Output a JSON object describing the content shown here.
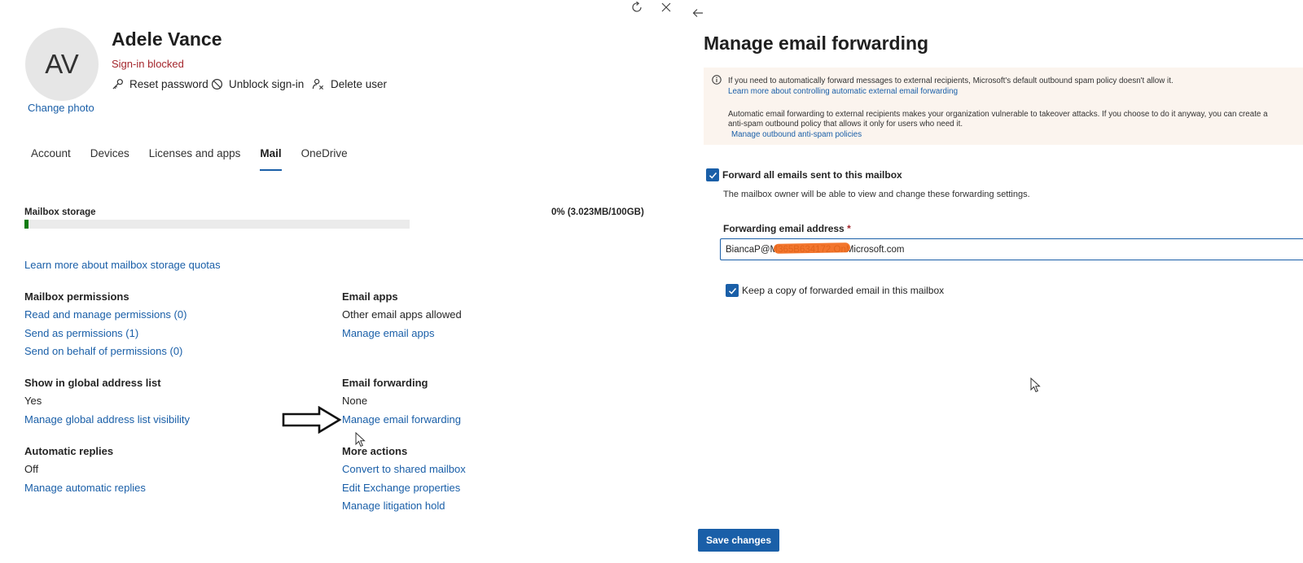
{
  "user": {
    "initials": "AV",
    "change_photo": "Change photo",
    "name": "Adele Vance",
    "status": "Sign-in blocked",
    "actions": {
      "reset_password": "Reset password",
      "unblock_signin": "Unblock sign-in",
      "delete_user": "Delete user"
    }
  },
  "tabs": [
    {
      "label": "Account"
    },
    {
      "label": "Devices"
    },
    {
      "label": "Licenses and apps"
    },
    {
      "label": "Mail"
    },
    {
      "label": "OneDrive"
    }
  ],
  "active_tab": "Mail",
  "mailbox": {
    "storage_label": "Mailbox storage",
    "storage_value": "0% (3.023MB/100GB)",
    "storage_percent": 1,
    "learn_more": "Learn more about mailbox storage quotas"
  },
  "sections": {
    "permissions": {
      "heading": "Mailbox permissions",
      "links": [
        "Read and manage permissions (0)",
        "Send as permissions (1)",
        "Send on behalf of permissions (0)"
      ]
    },
    "email_apps": {
      "heading": "Email apps",
      "value": "Other email apps allowed",
      "link": "Manage email apps"
    },
    "gal": {
      "heading": "Show in global address list",
      "value": "Yes",
      "link": "Manage global address list visibility"
    },
    "forwarding": {
      "heading": "Email forwarding",
      "value": "None",
      "link": "Manage email forwarding"
    },
    "auto_replies": {
      "heading": "Automatic replies",
      "value": "Off",
      "link": "Manage automatic replies"
    },
    "more_actions": {
      "heading": "More actions",
      "links": [
        "Convert to shared mailbox",
        "Edit Exchange properties",
        "Manage litigation hold"
      ]
    }
  },
  "panel": {
    "title": "Manage email forwarding",
    "info": {
      "line1": "If you need to automatically forward messages to external recipients, Microsoft's default outbound spam policy doesn't allow it.",
      "link1": "Learn more about controlling automatic external email forwarding",
      "line2": "Automatic email forwarding to external recipients makes your organization vulnerable to takeover attacks. If you choose to do it anyway, you can create a",
      "line3": "anti-spam outbound policy that allows it only for users who need it.",
      "link2": "Manage outbound anti-spam policies"
    },
    "forward_all": {
      "label": "Forward all emails sent to this mailbox",
      "checked": true,
      "hint": "The mailbox owner will be able to view and change these forwarding settings."
    },
    "forwarding_address": {
      "label": "Forwarding email address",
      "required_mark": "*",
      "value": "BiancaP@M365B634172.OnMicrosoft.com"
    },
    "keep_copy": {
      "label": "Keep a copy of forwarded email in this mailbox",
      "checked": true
    },
    "save_button": "Save changes"
  },
  "colors": {
    "accent": "#1a5fa8",
    "error": "#a4262c",
    "info_bg": "#fbf4ee",
    "redaction": "#f26a1b"
  }
}
